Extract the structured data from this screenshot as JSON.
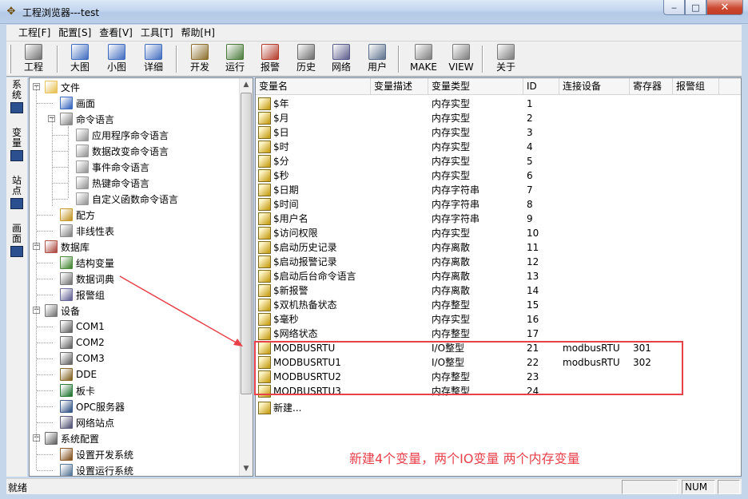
{
  "window": {
    "title": "工程浏览器---test",
    "minimize": "‒",
    "maximize": "□",
    "close": "✕"
  },
  "menu": [
    "工程[F]",
    "配置[S]",
    "查看[V]",
    "工具[T]",
    "帮助[H]"
  ],
  "toolbar": [
    {
      "label": "工程",
      "icon": "project-icon",
      "color": "#6f6f6f"
    },
    {
      "label": "大图",
      "icon": "large-icon-view-icon",
      "color": "#3f6bbf"
    },
    {
      "label": "小图",
      "icon": "small-icon-view-icon",
      "color": "#3f6bbf"
    },
    {
      "label": "详细",
      "icon": "detail-view-icon",
      "color": "#3f6bbf"
    },
    {
      "label": "开发",
      "icon": "develop-icon",
      "color": "#8a6d2b"
    },
    {
      "label": "运行",
      "icon": "run-icon",
      "color": "#4a7a3a"
    },
    {
      "label": "报警",
      "icon": "alarm-icon",
      "color": "#b33a2a"
    },
    {
      "label": "历史",
      "icon": "history-icon",
      "color": "#6b6b6b"
    },
    {
      "label": "网络",
      "icon": "network-icon",
      "color": "#5a5a8a"
    },
    {
      "label": "用户",
      "icon": "user-icon",
      "color": "#5a6f8a"
    },
    {
      "label": "MAKE",
      "icon": "make-icon",
      "color": "#7a7a7a"
    },
    {
      "label": "VIEW",
      "icon": "view-icon",
      "color": "#7a7a7a"
    },
    {
      "label": "关于",
      "icon": "about-icon",
      "color": "#7a7a7a"
    }
  ],
  "side_tabs": [
    "系统",
    "变量",
    "站点",
    "画面"
  ],
  "tree": [
    {
      "label": "文件",
      "icon": "folder-icon",
      "level": 0,
      "expander": "−",
      "color": "#e8c25a"
    },
    {
      "label": "画面",
      "icon": "picture-icon",
      "level": 1,
      "color": "#3f6bbf"
    },
    {
      "label": "命令语言",
      "icon": "command-icon",
      "level": 1,
      "expander": "−",
      "color": "#8a8a8a"
    },
    {
      "label": "应用程序命令语言",
      "icon": "script-icon",
      "level": 2,
      "color": "#9a9a9a"
    },
    {
      "label": "数据改变命令语言",
      "icon": "script-icon",
      "level": 2,
      "color": "#9a9a9a"
    },
    {
      "label": "事件命令语言",
      "icon": "script-icon",
      "level": 2,
      "color": "#9a9a9a"
    },
    {
      "label": "热键命令语言",
      "icon": "script-icon",
      "level": 2,
      "color": "#9a9a9a"
    },
    {
      "label": "自定义函数命令语言",
      "icon": "script-icon",
      "level": 2,
      "color": "#9a9a9a"
    },
    {
      "label": "配方",
      "icon": "recipe-icon",
      "level": 1,
      "color": "#c79a2e"
    },
    {
      "label": "非线性表",
      "icon": "table-icon",
      "level": 1,
      "color": "#8a8a8a"
    },
    {
      "label": "数据库",
      "icon": "database-icon",
      "level": 0,
      "expander": "−",
      "color": "#b0524a"
    },
    {
      "label": "结构变量",
      "icon": "struct-icon",
      "level": 1,
      "color": "#4a8a3a"
    },
    {
      "label": "数据词典",
      "icon": "dictionary-icon",
      "level": 1,
      "color": "#7a7a7a"
    },
    {
      "label": "报警组",
      "icon": "alarm-group-icon",
      "level": 1,
      "color": "#6a6a9a"
    },
    {
      "label": "设备",
      "icon": "device-icon",
      "level": 0,
      "expander": "−",
      "color": "#7a7a7a"
    },
    {
      "label": "COM1",
      "icon": "com-port-icon",
      "level": 1,
      "color": "#6a6a6a"
    },
    {
      "label": "COM2",
      "icon": "com-port-icon",
      "level": 1,
      "color": "#6a6a6a"
    },
    {
      "label": "COM3",
      "icon": "com-port-icon",
      "level": 1,
      "color": "#6a6a6a"
    },
    {
      "label": "DDE",
      "icon": "dde-icon",
      "level": 1,
      "color": "#8a6a2a"
    },
    {
      "label": "板卡",
      "icon": "card-icon",
      "level": 1,
      "color": "#2a7a3a"
    },
    {
      "label": "OPC服务器",
      "icon": "opc-server-icon",
      "level": 1,
      "color": "#3a5a8a"
    },
    {
      "label": "网络站点",
      "icon": "network-station-icon",
      "level": 1,
      "color": "#5a5a7a"
    },
    {
      "label": "系统配置",
      "icon": "tools-icon",
      "level": 0,
      "expander": "−",
      "color": "#6a6a6a"
    },
    {
      "label": "设置开发系统",
      "icon": "dev-setting-icon",
      "level": 1,
      "color": "#8a5a2a"
    },
    {
      "label": "设置运行系统",
      "icon": "run-setting-icon",
      "level": 1,
      "color": "#5a7a9a"
    }
  ],
  "list": {
    "columns": [
      "变量名",
      "变量描述",
      "变量类型",
      "ID",
      "连接设备",
      "寄存器",
      "报警组"
    ],
    "rows": [
      {
        "name": "$年",
        "desc": "",
        "type": "内存实型",
        "id": "1",
        "device": "",
        "register": "",
        "alarm": ""
      },
      {
        "name": "$月",
        "desc": "",
        "type": "内存实型",
        "id": "2",
        "device": "",
        "register": "",
        "alarm": ""
      },
      {
        "name": "$日",
        "desc": "",
        "type": "内存实型",
        "id": "3",
        "device": "",
        "register": "",
        "alarm": ""
      },
      {
        "name": "$时",
        "desc": "",
        "type": "内存实型",
        "id": "4",
        "device": "",
        "register": "",
        "alarm": ""
      },
      {
        "name": "$分",
        "desc": "",
        "type": "内存实型",
        "id": "5",
        "device": "",
        "register": "",
        "alarm": ""
      },
      {
        "name": "$秒",
        "desc": "",
        "type": "内存实型",
        "id": "6",
        "device": "",
        "register": "",
        "alarm": ""
      },
      {
        "name": "$日期",
        "desc": "",
        "type": "内存字符串",
        "id": "7",
        "device": "",
        "register": "",
        "alarm": ""
      },
      {
        "name": "$时间",
        "desc": "",
        "type": "内存字符串",
        "id": "8",
        "device": "",
        "register": "",
        "alarm": ""
      },
      {
        "name": "$用户名",
        "desc": "",
        "type": "内存字符串",
        "id": "9",
        "device": "",
        "register": "",
        "alarm": ""
      },
      {
        "name": "$访问权限",
        "desc": "",
        "type": "内存实型",
        "id": "10",
        "device": "",
        "register": "",
        "alarm": ""
      },
      {
        "name": "$启动历史记录",
        "desc": "",
        "type": "内存离散",
        "id": "11",
        "device": "",
        "register": "",
        "alarm": ""
      },
      {
        "name": "$启动报警记录",
        "desc": "",
        "type": "内存离散",
        "id": "12",
        "device": "",
        "register": "",
        "alarm": ""
      },
      {
        "name": "$启动后台命令语言",
        "desc": "",
        "type": "内存离散",
        "id": "13",
        "device": "",
        "register": "",
        "alarm": ""
      },
      {
        "name": "$新报警",
        "desc": "",
        "type": "内存离散",
        "id": "14",
        "device": "",
        "register": "",
        "alarm": ""
      },
      {
        "name": "$双机热备状态",
        "desc": "",
        "type": "内存整型",
        "id": "15",
        "device": "",
        "register": "",
        "alarm": ""
      },
      {
        "name": "$毫秒",
        "desc": "",
        "type": "内存实型",
        "id": "16",
        "device": "",
        "register": "",
        "alarm": ""
      },
      {
        "name": "$网络状态",
        "desc": "",
        "type": "内存整型",
        "id": "17",
        "device": "",
        "register": "",
        "alarm": ""
      },
      {
        "name": "MODBUSRTU",
        "desc": "",
        "type": "I/O整型",
        "id": "21",
        "device": "modbusRTU",
        "register": "301",
        "alarm": ""
      },
      {
        "name": "MODBUSRTU1",
        "desc": "",
        "type": "I/O整型",
        "id": "22",
        "device": "modbusRTU",
        "register": "302",
        "alarm": ""
      },
      {
        "name": "MODBUSRTU2",
        "desc": "",
        "type": "内存整型",
        "id": "23",
        "device": "",
        "register": "",
        "alarm": ""
      },
      {
        "name": "MODBUSRTU3",
        "desc": "",
        "type": "内存整型",
        "id": "24",
        "device": "",
        "register": "",
        "alarm": ""
      }
    ],
    "new_item": "新建..."
  },
  "annotation": "新建4个变量，两个IO变量 两个内存变量",
  "status": {
    "text": "就绪",
    "num": "NUM"
  },
  "colors": {
    "accent_red": "#e8414a",
    "var_icon": "#c9a21e"
  }
}
